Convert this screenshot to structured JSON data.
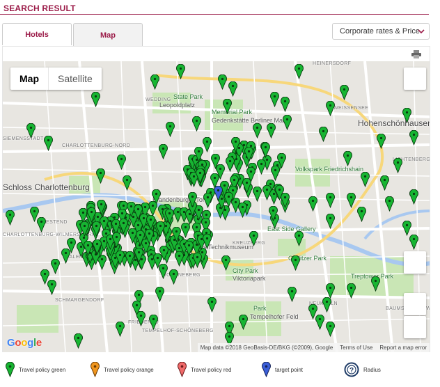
{
  "header": {
    "title": "SEARCH RESULT"
  },
  "tabs": [
    {
      "label": "Hotels"
    },
    {
      "label": "Map"
    }
  ],
  "sort": {
    "selected": "Corporate rates & Price"
  },
  "map": {
    "maptype": {
      "map_label": "Map",
      "satellite_label": "Satellite"
    },
    "labels": [
      "HEINERSDORF",
      "State Park",
      "Leopoldplatz",
      "WEDDING",
      "Memorial Park",
      "Gedenkstätte Berliner Mauer",
      "WEISSENSEE",
      "Hohenschönhausen",
      "SIEMENSSTADT",
      "CHARLOTTENBURG-NORD",
      "Schloss Charlottenburg",
      "Volkspark Friedrichshain",
      "LICHTENBERG",
      "Brandenburger Tor",
      "East Side Gallery",
      "WESTEND",
      "CHARLOTTENBURG-WILMERSDORF",
      "Deutsches Technikmuseum",
      "KREUZBERG",
      "Görlitzer Park",
      "Treptower Park",
      "City Park",
      "Viktoriapark",
      "SCHÖNEBERG",
      "SCHMARGENDORF",
      "Park",
      "Tempelhofer Feld",
      "NEUKÖLLN",
      "FRIEDENAU",
      "TEMPELHOF-SCHÖNEBERG",
      "HALENSEE",
      "BAUMSCHULENWEG"
    ],
    "attribution": {
      "data": "Map data ©2018 GeoBasis-DE/BKG (©2009), Google",
      "terms": "Terms of Use",
      "report": "Report a map error"
    },
    "logo": "Google"
  },
  "legend": [
    {
      "label": "Travel policy green",
      "color": "#17b532"
    },
    {
      "label": "Travel policy orange",
      "color": "#f0961e"
    },
    {
      "label": "Travel policy red",
      "color": "#ef6a6a"
    },
    {
      "label": "target point",
      "color": "#3b5fd9"
    },
    {
      "label": "Radius",
      "color": "#1d3a66"
    }
  ]
}
